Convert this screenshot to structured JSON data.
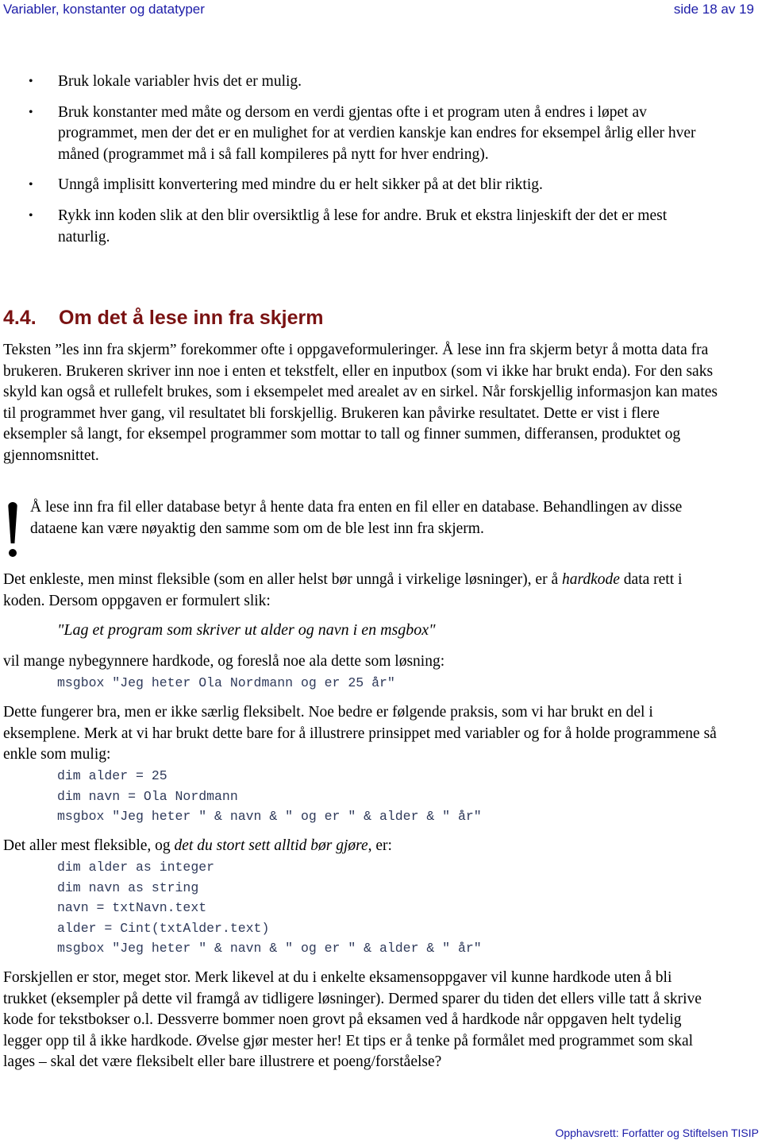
{
  "header": {
    "title": "Variabler, konstanter og datatyper",
    "page": "side 18 av 19"
  },
  "bullets": [
    "Bruk lokale variabler hvis det er mulig.",
    "Bruk konstanter med måte og dersom en verdi gjentas ofte i et program uten å endres i løpet av programmet, men der det er en mulighet for at verdien kanskje kan endres for eksempel årlig eller hver måned (programmet må i så fall kompileres på nytt for hver endring).",
    "Unngå implisitt konvertering med mindre du er helt sikker på at det blir riktig.",
    "Rykk inn koden slik at den blir oversiktlig å lese for andre. Bruk et ekstra linjeskift der det er mest naturlig."
  ],
  "section": {
    "number": "4.4.",
    "title": "Om det å lese inn fra skjerm"
  },
  "intro_paragraph": "Teksten ”les inn fra skjerm” forekommer ofte i oppgaveformuleringer. Å lese inn fra skjerm betyr å motta data fra brukeren. Brukeren skriver inn noe i enten et tekstfelt, eller en inputbox (som vi ikke har brukt enda). For den saks skyld kan også et rullefelt brukes, som i eksempelet med arealet av en sirkel. Når forskjellig informasjon kan mates til programmet hver gang, vil resultatet bli forskjellig. Brukeren kan påvirke resultatet. Dette er vist i flere eksempler så langt, for eksempel programmer som mottar to tall og finner summen, differansen, produktet og gjennomsnittet.",
  "note": {
    "icon": "exclamation-icon",
    "text": "Å lese inn fra fil eller database betyr å hente data fra enten en fil eller en database. Behandlingen av disse dataene kan være nøyaktig den samme som om de ble lest inn fra skjerm."
  },
  "hardcode_paragraph": {
    "before": "Det enkleste, men minst fleksible (som en aller helst bør unngå i virkelige løsninger), er å ",
    "emphasis": "hardkode",
    "after": " data rett i koden. Dersom oppgaven er formulert slik:"
  },
  "quote": "\"Lag et program som skriver ut alder og navn i en msgbox\"",
  "novice_intro": "vil mange nybegynnere hardkode, og foreslå noe ala dette som løsning:",
  "code_hardcoded": [
    "msgbox \"Jeg heter Ola Nordmann og er 25 år\""
  ],
  "better_paragraph": "Dette fungerer bra, men er ikke særlig fleksibelt. Noe bedre er følgende praksis, som vi har brukt en del i eksemplene. Merk at vi har brukt dette bare for å illustrere prinsippet med variabler og for å holde programmene så enkle som mulig:",
  "code_variables": [
    "dim alder = 25",
    "dim navn = Ola Nordmann",
    "msgbox \"Jeg heter \" & navn & \" og er \" & alder & \" år\""
  ],
  "flexible_paragraph": {
    "before": "Det aller mest fleksible, og ",
    "emphasis": "det du stort sett alltid bør gjøre",
    "after": ", er:"
  },
  "code_flexible": [
    "dim alder as integer",
    "dim navn as string",
    "navn = txtNavn.text",
    "alder = Cint(txtAlder.text)",
    "msgbox \"Jeg heter \" & navn & \" og er \" & alder & \" år\""
  ],
  "closing_paragraph": "Forskjellen er stor, meget stor. Merk likevel at du i enkelte eksamensoppgaver vil kunne hardkode uten å bli trukket (eksempler på dette vil framgå av tidligere løsninger). Dermed sparer du tiden det ellers ville tatt å skrive kode for tekstbokser o.l. Dessverre bommer noen grovt på eksamen ved å hardkode når oppgaven helt tydelig legger opp til å ikke hardkode. Øvelse gjør mester her! Et tips er å tenke på formålet med programmet som skal lages – skal det være fleksibelt eller bare illustrere et poeng/forståelse?",
  "footer": "Opphavsrett:  Forfatter og Stiftelsen TISIP",
  "colors": {
    "header_blue": "#1c1ca8",
    "heading_red": "#7a1212",
    "code_text": "#2f3a5a"
  }
}
